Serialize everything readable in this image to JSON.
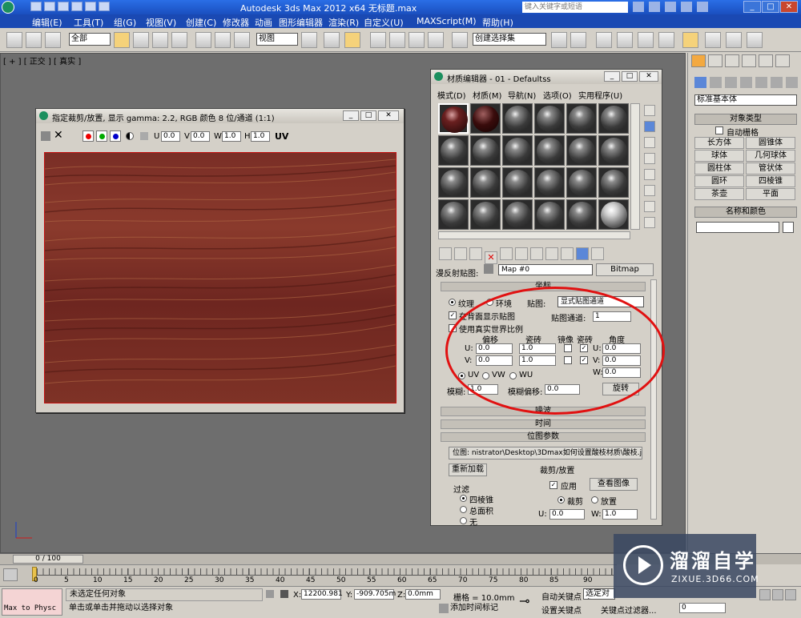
{
  "title_bar": {
    "title": "Autodesk 3ds Max  2012 x64  无标题.max",
    "search_placeholder": "键入关键字或短语"
  },
  "menu": [
    "编辑(E)",
    "工具(T)",
    "组(G)",
    "视图(V)",
    "创建(C)",
    "修改器",
    "动画",
    "图形编辑器",
    "渲染(R)",
    "自定义(U)",
    "MAXScript(M)",
    "帮助(H)"
  ],
  "toolbar": {
    "selection_filter": "全部",
    "ref_coord": "视图",
    "named_selection": "创建选择集"
  },
  "viewport": {
    "label": "[ + ] [ 正交 ] [ 真实 ]"
  },
  "crop_window": {
    "title": "指定裁剪/放置, 显示 gamma: 2.2, RGB 颜色 8 位/通道 (1:1)",
    "u_label": "U",
    "u_value": "0.0",
    "v_label": "V",
    "v_value": "0.0",
    "w_label": "W",
    "w_value": "1.0",
    "h_label": "H",
    "h_value": "1.0",
    "uv_label": "UV"
  },
  "material_editor": {
    "title": "材质编辑器 - 01 - Defaultss",
    "menu": [
      "模式(D)",
      "材质(M)",
      "导航(N)",
      "选项(O)",
      "实用程序(U)"
    ],
    "map_label": "漫反射贴图:",
    "map_name": "Map #0",
    "map_type": "Bitmap",
    "coords_rollout": "坐标",
    "texture_label": "纹理",
    "environ_label": "环境",
    "mapping_label": "贴图:",
    "mapping_value": "显式贴图通道",
    "show_back_label": "在背面显示贴图",
    "map_channel_label": "贴图通道:",
    "map_channel_value": "1",
    "real_world_label": "使用真实世界比例",
    "offset_label": "偏移",
    "tiling_label": "瓷砖",
    "mirror_label": "镜像",
    "tile_label": "瓷砖",
    "angle_label": "角度",
    "u": "U:",
    "v": "V:",
    "w": "W:",
    "u_offset": "0.0",
    "v_offset": "0.0",
    "u_tiling": "1.0",
    "v_tiling": "1.0",
    "u_angle": "0.0",
    "v_angle": "0.0",
    "w_angle": "0.0",
    "uv": "UV",
    "vw": "VW",
    "wu": "WU",
    "blur_label": "模糊:",
    "blur_value": "1.0",
    "blur_offset_label": "模糊偏移:",
    "blur_offset_value": "0.0",
    "rotate_label": "旋转",
    "noise_rollout": "噪波",
    "time_rollout": "时间",
    "bitmap_params_rollout": "位图参数",
    "bitmap_path": "位图: nistrator\\Desktop\\3Dmax如何设置酸枝材质\\酸枝.jpg",
    "reload_label": "重新加载",
    "crop_place_label": "裁剪/放置",
    "apply_label": "应用",
    "view_image_label": "查看图像",
    "crop_label": "裁剪",
    "place_label": "放置",
    "filter_label": "过滤",
    "filter_options": [
      "四棱锥",
      "总面积",
      "无"
    ],
    "crop_u_label": "U:",
    "crop_u_value": "0.0",
    "crop_w_label": "W:",
    "crop_w_value": "1.0"
  },
  "command_panel": {
    "category": "标准基本体",
    "object_type_rollout": "对象类型",
    "autogrid_label": "自动栅格",
    "objects": [
      "长方体",
      "圆锥体",
      "球体",
      "几何球体",
      "圆柱体",
      "管状体",
      "圆环",
      "四棱锥",
      "茶壶",
      "平面"
    ],
    "name_color_rollout": "名称和颜色"
  },
  "timeline": {
    "frame_counter": "0 / 100",
    "ticks": [
      "0",
      "5",
      "10",
      "15",
      "20",
      "25",
      "30",
      "35",
      "40",
      "45",
      "50",
      "55",
      "60",
      "65",
      "70",
      "75",
      "80",
      "85",
      "90"
    ]
  },
  "status": {
    "maxscript": "Max to Physc",
    "selection_status": "未选定任何对象",
    "prompt": "单击或单击并拖动以选择对象",
    "x_label": "X:",
    "x_value": "12200.981",
    "y_label": "Y:",
    "y_value": "-909.705m",
    "z_label": "Z:",
    "z_value": "0.0mm",
    "grid": "栅格 = 10.0mm",
    "add_time_tag": "添加时间标记",
    "auto_key": "自动关键点",
    "selected": "选定对象",
    "set_key": "设置关键点",
    "key_filters": "关键点过滤器...",
    "frame": "0"
  },
  "brand": {
    "name": "溜溜自学",
    "url": "ZIXUE.3D66.COM"
  }
}
